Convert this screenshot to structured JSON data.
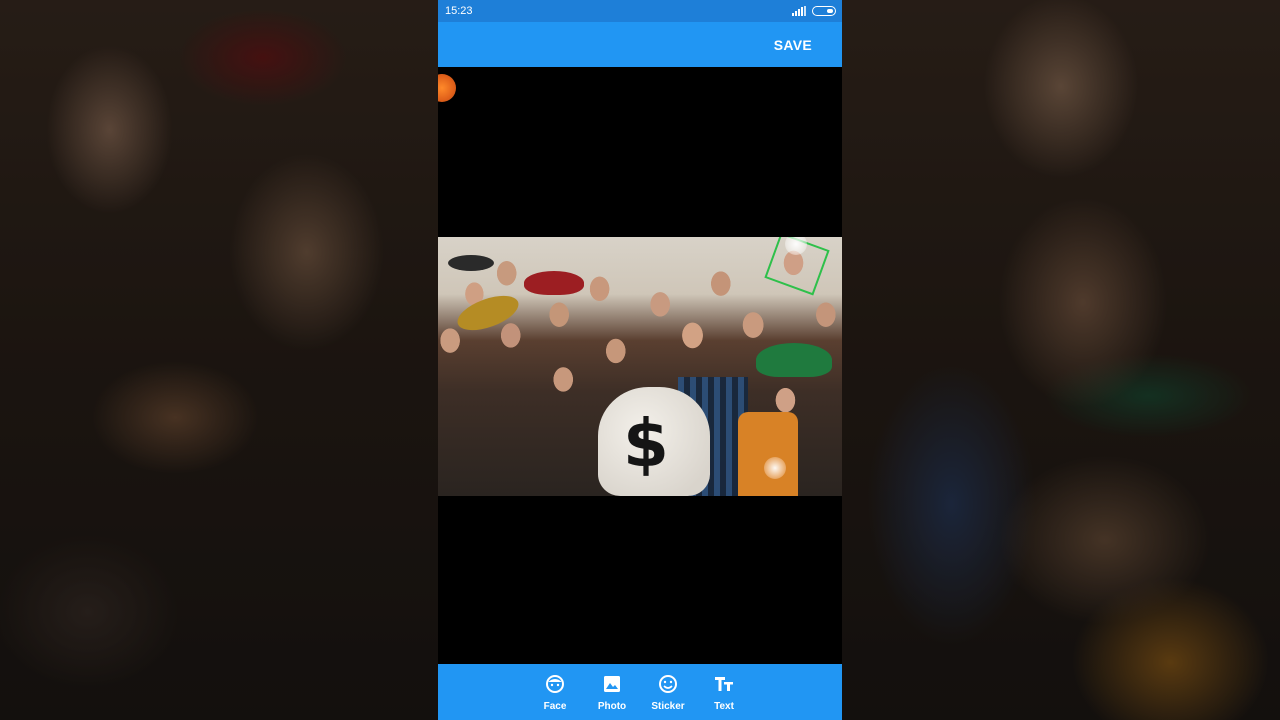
{
  "status_bar": {
    "time": "15:23"
  },
  "app_bar": {
    "save_label": "SAVE"
  },
  "tools": [
    {
      "label": "Face",
      "icon": "face-icon"
    },
    {
      "label": "Photo",
      "icon": "photo-icon"
    },
    {
      "label": "Sticker",
      "icon": "sticker-icon"
    },
    {
      "label": "Text",
      "icon": "text-icon"
    }
  ],
  "photo": {
    "symbol": "$"
  },
  "colors": {
    "status_bar": "#1e7fd8",
    "app_bar": "#2196f3",
    "toolbar": "#2196f3",
    "face_marker": "#2ec04a"
  }
}
